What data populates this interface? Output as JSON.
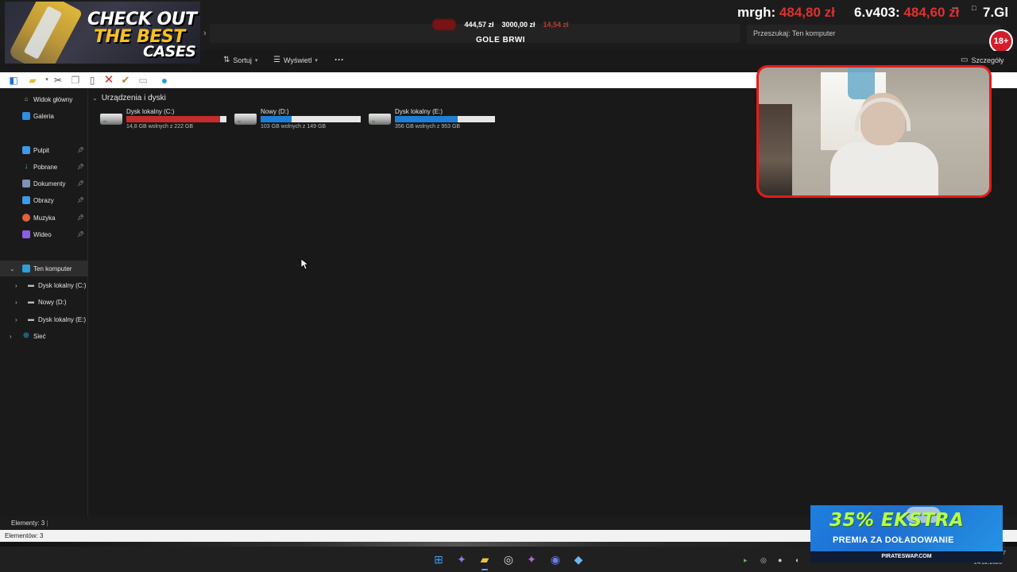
{
  "overlay": {
    "promo": {
      "line1": "CHECK OUT",
      "line2": "THE BEST",
      "line3": "CASES"
    },
    "center_stats": {
      "value1": "444,57 zł",
      "value2": "3000,00 zł",
      "value3": "14,54 zł",
      "title": "GOLE BRWI"
    },
    "scores": [
      {
        "label": "mrgh:",
        "value": "484,80 zł"
      },
      {
        "label": "6.v403:",
        "value": "484,60 zł"
      },
      {
        "label": "7.Gl",
        "value": ""
      }
    ],
    "age_badge": "18+",
    "ad": {
      "headline": "35% EKSTRA",
      "subline": "PREMIA ZA DOŁADOWANIE",
      "site": "PIRATESWAP.COM"
    }
  },
  "explorer": {
    "search_placeholder": "Przeszukaj: Ten komputer",
    "toolbar": {
      "sort_label": "Sortuj",
      "view_label": "Wyświetl",
      "more_label": "···",
      "details_label": "Szczegóły"
    },
    "nav": {
      "home": "Widok główny",
      "gallery": "Galeria",
      "pinned": [
        {
          "label": "Pulpit",
          "icon": "desktop-icon",
          "color": "#3d9ae8"
        },
        {
          "label": "Pobrane",
          "icon": "download-icon",
          "color": "#3fbf7f"
        },
        {
          "label": "Dokumenty",
          "icon": "document-icon",
          "color": "#7d93b8"
        },
        {
          "label": "Obrazy",
          "icon": "pictures-icon",
          "color": "#3d9ae8"
        },
        {
          "label": "Muzyka",
          "icon": "music-icon",
          "color": "#e0623b"
        },
        {
          "label": "Wideo",
          "icon": "video-icon",
          "color": "#8a5ee8"
        }
      ],
      "this_pc": "Ten komputer",
      "drives": [
        "Dysk lokalny (C:)",
        "Nowy (D:)",
        "Dysk lokalny (E:)"
      ],
      "network": "Sieć"
    },
    "section_title": "Urządzenia i dyski",
    "drives": [
      {
        "name": "Dysk lokalny (C:)",
        "free_text": "14,8 GB wolnych z 222 GB",
        "used_fraction": 0.933,
        "bar_color": "#c42b2b"
      },
      {
        "name": "Nowy (D:)",
        "free_text": "103 GB wolnych z 149 GB",
        "used_fraction": 0.309,
        "bar_color": "#1f7fd6"
      },
      {
        "name": "Dysk lokalny (E:)",
        "free_text": "356 GB wolnych z 953 GB",
        "used_fraction": 0.626,
        "bar_color": "#1f7fd6"
      }
    ],
    "status_top": "Elementy: 3",
    "status_bottom": "Elementów: 3"
  },
  "taskbar": {
    "date": "24.02.2026",
    "time": "7"
  }
}
